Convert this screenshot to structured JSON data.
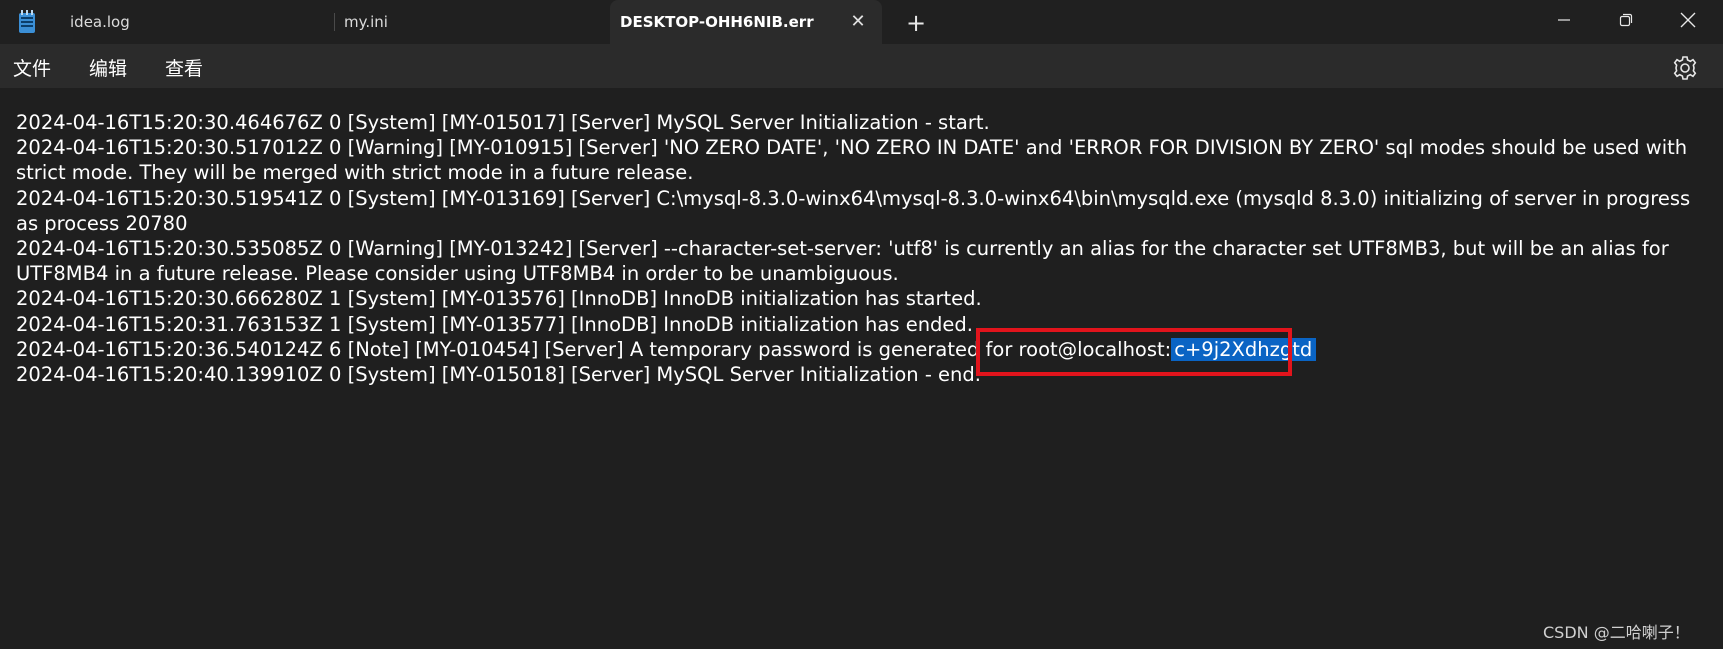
{
  "titlebar": {
    "tabs": [
      {
        "label": "idea.log"
      },
      {
        "label": "my.ini"
      },
      {
        "label": "DESKTOP-OHH6NIB.err",
        "active": true
      }
    ],
    "close_glyph": "✕",
    "new_tab_glyph": "+"
  },
  "menu": {
    "file": "文件",
    "edit": "编辑",
    "view": "查看"
  },
  "log": {
    "lines": [
      "2024-04-16T15:20:30.464676Z 0 [System] [MY-015017] [Server] MySQL Server Initialization - start.",
      "2024-04-16T15:20:30.517012Z 0 [Warning] [MY-010915] [Server] 'NO ZERO DATE', 'NO ZERO IN DATE' and 'ERROR FOR DIVISION BY ZERO' sql modes should be used with strict mode. They will be merged with strict mode in a future release.",
      "2024-04-16T15:20:30.519541Z 0 [System] [MY-013169] [Server] C:\\mysql-8.3.0-winx64\\mysql-8.3.0-winx64\\bin\\mysqld.exe (mysqld 8.3.0) initializing of server in progress as process 20780",
      "2024-04-16T15:20:30.535085Z 0 [Warning] [MY-013242] [Server] --character-set-server: 'utf8' is currently an alias for the character set UTF8MB3, but will be an alias for UTF8MB4 in a future release. Please consider using UTF8MB4 in order to be unambiguous.",
      "2024-04-16T15:20:30.666280Z 1 [System] [MY-013576] [InnoDB] InnoDB initialization has started.",
      "2024-04-16T15:20:31.763153Z 1 [System] [MY-013577] [InnoDB] InnoDB initialization has ended."
    ],
    "password_line_prefix": "2024-04-16T15:20:36.540124Z 6 [Note] [MY-010454] [Server] A temporary password is generated for root@localhost:",
    "password": "c+9j2Xdhzgtd",
    "last_line": "2024-04-16T15:20:40.139910Z 0 [System] [MY-015018] [Server] MySQL Server Initialization - end."
  },
  "watermark": "CSDN @二哈喇子！",
  "colors": {
    "background": "#1f1f1f",
    "selection": "#0a64c4",
    "highlight_border": "#e2141c"
  }
}
